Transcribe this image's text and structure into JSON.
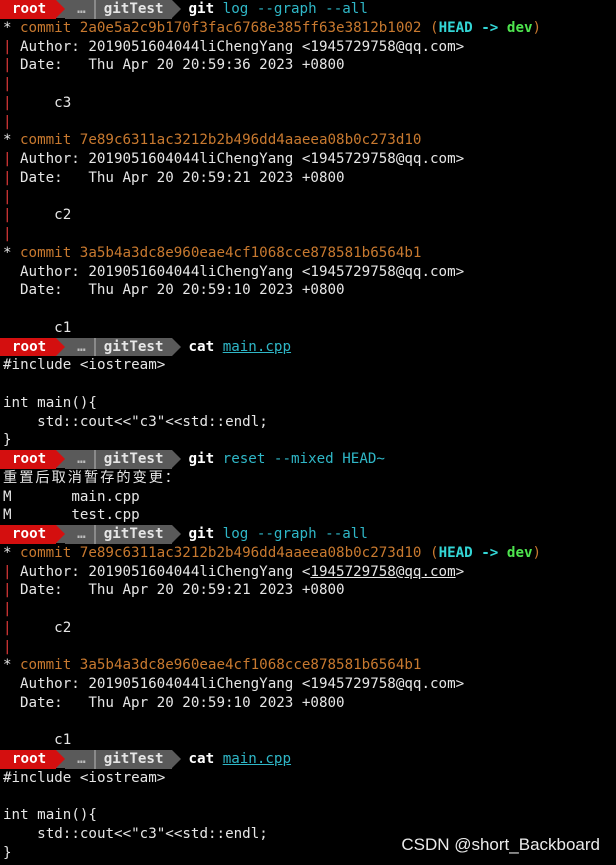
{
  "prompt": {
    "user": "root",
    "dots": "…",
    "repo": "gitTest"
  },
  "blocks": {
    "cmd1": {
      "cmd": "git",
      "args": " log --graph --all"
    },
    "log1": {
      "c3": {
        "commit": "commit 2a0e5a2c9b170f3fac6768e385ff63e3812b1002",
        "ref_open": " (",
        "head": "HEAD -> ",
        "branch": "dev",
        "ref_close": ")",
        "author": "Author: 2019051604044liChengYang <1945729758@qq.com>",
        "date": "Date:   Thu Apr 20 20:59:36 2023 +0800",
        "msg": "    c3"
      },
      "c2": {
        "commit": "commit 7e89c6311ac3212b2b496dd4aaeea08b0c273d10",
        "author": "Author: 2019051604044liChengYang <1945729758@qq.com>",
        "date": "Date:   Thu Apr 20 20:59:21 2023 +0800",
        "msg": "    c2"
      },
      "c1": {
        "commit": "commit 3a5b4a3dc8e960eae4cf1068cce878581b6564b1",
        "author": "Author: 2019051604044liChengYang <1945729758@qq.com>",
        "date": "Date:   Thu Apr 20 20:59:10 2023 +0800",
        "msg": "    c1"
      }
    },
    "cmd2": {
      "cmd": "cat",
      "file": "main.cpp"
    },
    "cat1": {
      "l1": "#include <iostream>",
      "l2": "",
      "l3": "int main(){",
      "l4": "    std::cout<<\"c3\"<<std::endl;",
      "l5": "}"
    },
    "cmd3": {
      "cmd": "git",
      "args": " reset --mixed HEAD~"
    },
    "reset_out": {
      "title": "重置后取消暂存的变更：",
      "m1": "M       main.cpp",
      "m2": "M       test.cpp"
    },
    "cmd4": {
      "cmd": "git",
      "args": " log --graph --all"
    },
    "log2": {
      "c2": {
        "commit": "commit 7e89c6311ac3212b2b496dd4aaeea08b0c273d10",
        "ref_open": " (",
        "head": "HEAD -> ",
        "branch": "dev",
        "ref_close": ")",
        "author_pre": "Author: 2019051604044liChengYang <",
        "author_email": "1945729758@qq.com",
        "author_post": ">",
        "date": "Date:   Thu Apr 20 20:59:21 2023 +0800",
        "msg": "    c2"
      },
      "c1": {
        "commit": "commit 3a5b4a3dc8e960eae4cf1068cce878581b6564b1",
        "author": "Author: 2019051604044liChengYang <1945729758@qq.com>",
        "date": "Date:   Thu Apr 20 20:59:10 2023 +0800",
        "msg": "    c1"
      }
    },
    "cmd5": {
      "cmd": "cat",
      "file": "main.cpp"
    },
    "cat2": {
      "l1": "#include <iostream>",
      "l2": "",
      "l3": "int main(){",
      "l4": "    std::cout<<\"c3\"<<std::endl;",
      "l5": "}"
    }
  },
  "graph": {
    "star": "*",
    "bar": "|"
  },
  "watermark": "CSDN @short_Backboard",
  "colors": {
    "background": "#000000",
    "prompt_root_bg": "#d40f0f",
    "prompt_segment_bg": "#5a5a5a",
    "hash": "#c8792f",
    "head": "#33d6d6",
    "branch": "#4ee44e",
    "graph_bar": "#e03a3a",
    "link": "#2fb7c7"
  }
}
